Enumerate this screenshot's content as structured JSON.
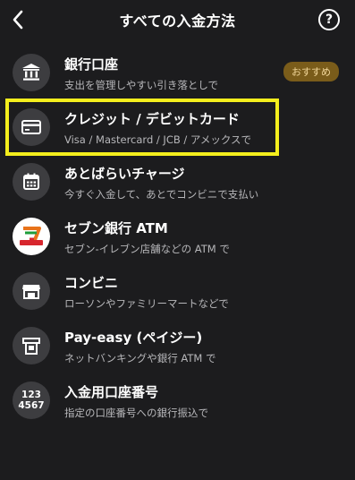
{
  "header": {
    "title": "すべての入金方法",
    "help_label": "?"
  },
  "methods": [
    {
      "title": "銀行口座",
      "subtitle": "支出を管理しやすい引き落としで",
      "badge": "おすすめ",
      "icon": "bank-icon"
    },
    {
      "title": "クレジット / デビットカード",
      "subtitle": "Visa / Mastercard / JCB / アメックスで",
      "icon": "credit-card-icon"
    },
    {
      "title": "あとばらいチャージ",
      "subtitle": "今すぐ入金して、あとでコンビニで支払い",
      "icon": "calendar-icon"
    },
    {
      "title": "セブン銀行 ATM",
      "subtitle": "セブン-イレブン店舗などの ATM で",
      "icon": "seven-bank-logo-icon"
    },
    {
      "title": "コンビニ",
      "subtitle": "ローソンやファミリーマートなどで",
      "icon": "convenience-store-icon"
    },
    {
      "title": "Pay-easy (ペイジー)",
      "subtitle": "ネットバンキングや銀行 ATM で",
      "icon": "atm-icon"
    },
    {
      "title": "入金用口座番号",
      "subtitle": "指定の口座番号への銀行振込で",
      "icon": "account-number-icon",
      "icon_text_line1": "123",
      "icon_text_line2": "4567"
    }
  ],
  "colors": {
    "background": "#1c1c1e",
    "icon_circle": "#3d3d40",
    "highlight": "#f4ee1d",
    "badge_bg": "#7a5c1a",
    "badge_text": "#f2d79a"
  }
}
